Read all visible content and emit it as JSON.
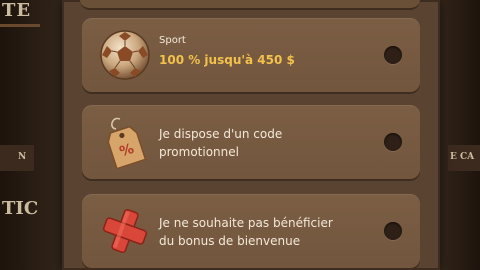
{
  "background": {
    "top_text": "TE",
    "mid_text": "TIC",
    "left_label": "N",
    "right_label": "E CA"
  },
  "options": [
    {
      "title": "Sport",
      "subtitle": "100 % jusqu'à 450 $",
      "icon": "soccer-ball-icon",
      "selected": false
    },
    {
      "line1": "Je dispose d'un code",
      "line2": "promotionnel",
      "icon": "price-tag-icon",
      "selected": false
    },
    {
      "line1": "Je ne souhaite pas bénéficier",
      "line2": "du bonus de bienvenue",
      "icon": "red-cross-icon",
      "selected": false
    }
  ],
  "colors": {
    "accent": "#f3c14d",
    "panel": "#5a4431",
    "option": "#7b5e44"
  }
}
